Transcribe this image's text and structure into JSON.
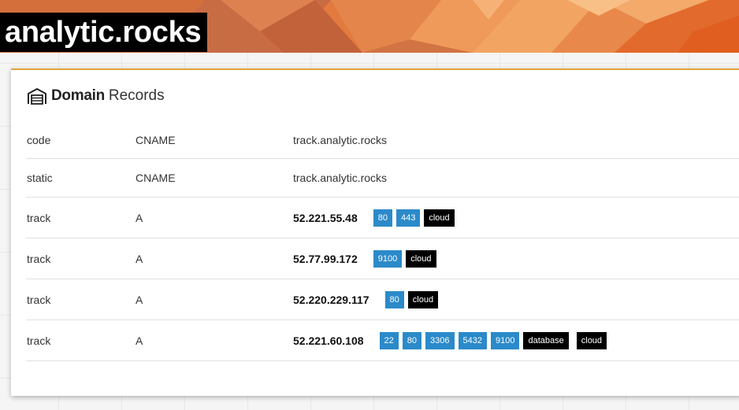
{
  "brand": {
    "logo_text": "analytic.rocks",
    "hero_colors": [
      "#c9663a",
      "#d8743f",
      "#e5854a",
      "#f09a5c",
      "#e36f2f",
      "#bd5e37",
      "#f2a56a"
    ]
  },
  "card": {
    "title_bold": "Domain",
    "title_light": "Records",
    "icon": "warehouse-icon",
    "accent_color": "#e8a33a"
  },
  "records": [
    {
      "name": "code",
      "type": "CNAME",
      "value": "track.analytic.rocks",
      "value_bold": false,
      "ports": [],
      "tags": []
    },
    {
      "name": "static",
      "type": "CNAME",
      "value": "track.analytic.rocks",
      "value_bold": false,
      "ports": [],
      "tags": []
    },
    {
      "name": "track",
      "type": "A",
      "value": "52.221.55.48",
      "value_bold": true,
      "ports": [
        "80",
        "443"
      ],
      "tags": [
        "cloud"
      ]
    },
    {
      "name": "track",
      "type": "A",
      "value": "52.77.99.172",
      "value_bold": true,
      "ports": [
        "9100"
      ],
      "tags": [
        "cloud"
      ]
    },
    {
      "name": "track",
      "type": "A",
      "value": "52.220.229.117",
      "value_bold": true,
      "ports": [
        "80"
      ],
      "tags": [
        "cloud"
      ]
    },
    {
      "name": "track",
      "type": "A",
      "value": "52.221.60.108",
      "value_bold": true,
      "ports": [
        "22",
        "80",
        "3306",
        "5432",
        "9100"
      ],
      "tags": [
        "database",
        "cloud"
      ]
    }
  ],
  "colors": {
    "port_badge": "#2b8ac9",
    "tag_badge": "#000000"
  }
}
